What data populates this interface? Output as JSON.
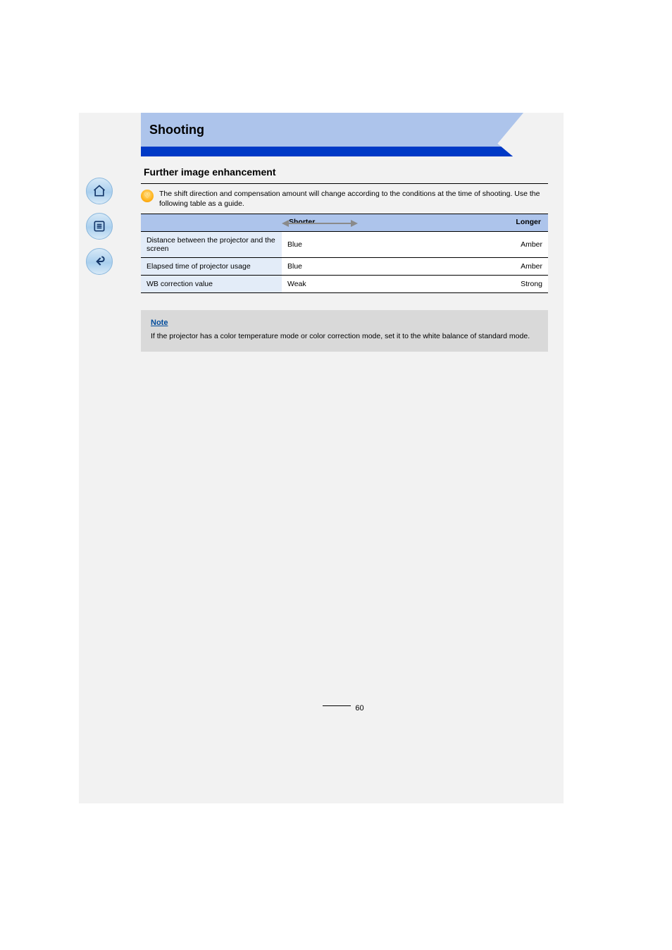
{
  "banner": {
    "title": "Shooting"
  },
  "section_heading": "Further image enhancement",
  "tip": "The shift direction and compensation amount will change according to the conditions at the time of shooting. Use the following table as a guide.",
  "table": {
    "header_left": "",
    "header_right_left": "Shorter",
    "header_right_right": "Longer",
    "rows": [
      {
        "left": "Distance between the projector and the screen",
        "right_left": "Blue",
        "right_right": "Amber"
      },
      {
        "left": "Elapsed time of projector usage",
        "right_left": "Blue",
        "right_right": "Amber"
      },
      {
        "left": "WB correction value",
        "right_left": "Weak",
        "right_right": "Strong"
      }
    ]
  },
  "note": {
    "label": "Note",
    "body": "If the projector has a color temperature mode or color correction mode, set it to the white balance of standard mode."
  },
  "footer_page": "60"
}
